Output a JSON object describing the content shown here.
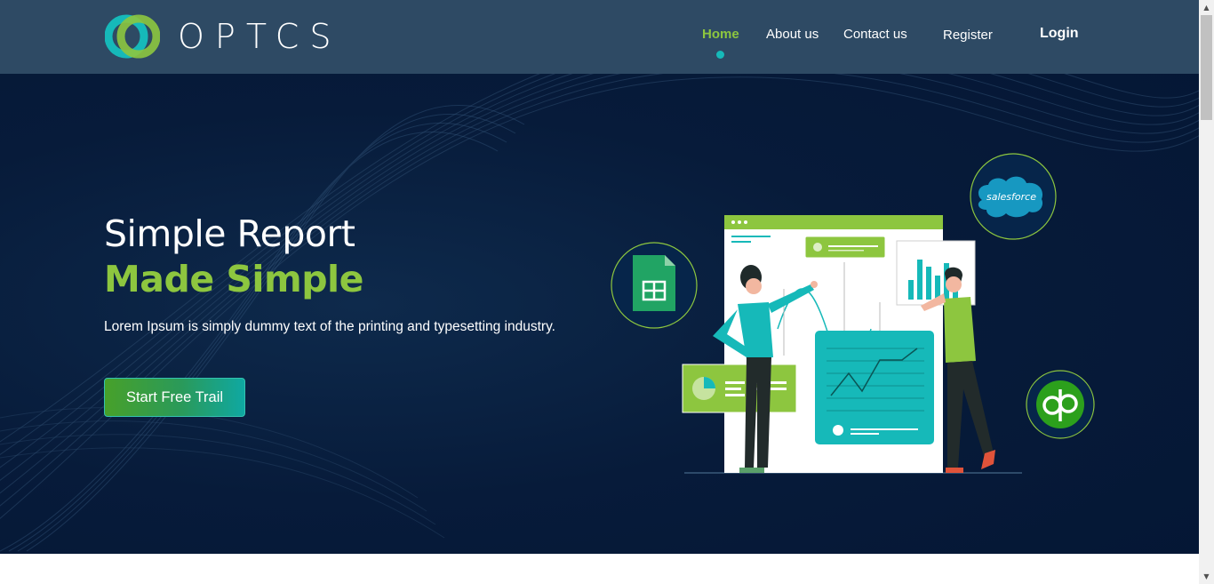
{
  "brand": {
    "name": "OPTCS",
    "logo_colors": {
      "teal": "#16b9b9",
      "green": "#8dc63f"
    }
  },
  "nav": {
    "items": [
      {
        "label": "Home",
        "active": true
      },
      {
        "label": "About us",
        "active": false
      },
      {
        "label": "Contact us",
        "active": false
      },
      {
        "label": "Register",
        "active": false
      },
      {
        "label": "Login",
        "active": false
      }
    ]
  },
  "hero": {
    "title_line1": "Simple Report",
    "title_line2": "Made Simple",
    "lead": "Lorem Ipsum is simply dummy text of the printing and typesetting industry.",
    "cta_label": "Start Free Trail"
  },
  "illustration": {
    "badges": [
      {
        "name": "google-sheets-icon"
      },
      {
        "name": "salesforce-logo",
        "text": "salesforce"
      },
      {
        "name": "quickbooks-logo"
      }
    ]
  },
  "colors": {
    "accent_green": "#8dc63f",
    "accent_teal": "#16b9b9",
    "navbar_bg": "#2e4a64",
    "hero_bg": "#071b3a"
  }
}
